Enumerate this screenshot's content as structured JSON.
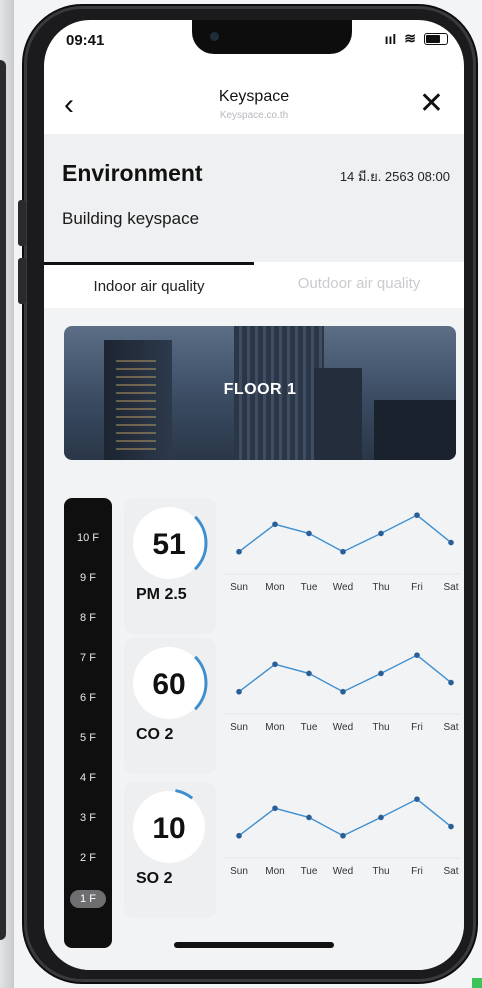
{
  "status": {
    "time": "09:41",
    "signal": "ııl",
    "wifi": "≋"
  },
  "nav": {
    "back_icon": "chevron-left",
    "title": "Keyspace",
    "subtitle": "Keyspace.co.th",
    "close_icon": "close"
  },
  "header": {
    "title": "Environment",
    "date": "14 มี.ย. 2563  08:00",
    "building": "Building keyspace"
  },
  "tabs": [
    {
      "label": "Indoor air quality",
      "active": true
    },
    {
      "label": "Outdoor air quality",
      "active": false
    }
  ],
  "banner": {
    "label": "FLOOR 1"
  },
  "floors": [
    "10 F",
    "9 F",
    "8 F",
    "7 F",
    "6 F",
    "5 F",
    "4 F",
    "3 F",
    "2 F",
    "1 F"
  ],
  "selected_floor": "1 F",
  "days": [
    "Sun",
    "Mon",
    "Tue",
    "Wed",
    "Thu",
    "Fri",
    "Sat"
  ],
  "metrics": [
    {
      "name": "PM 2.5",
      "value": "51",
      "gauge_fraction": 0.25,
      "trend": [
        2,
        5,
        4,
        2,
        4,
        6,
        3
      ]
    },
    {
      "name": "CO 2",
      "value": "60",
      "gauge_fraction": 0.25,
      "trend": [
        2,
        5,
        4,
        2,
        4,
        6,
        3
      ]
    },
    {
      "name": "SO 2",
      "value": "10",
      "gauge_fraction": 0.08,
      "trend": [
        2,
        5,
        4,
        2,
        4,
        6,
        3
      ]
    }
  ],
  "colors": {
    "accent": "#3e8fd0",
    "rail": "#0f0f10"
  }
}
